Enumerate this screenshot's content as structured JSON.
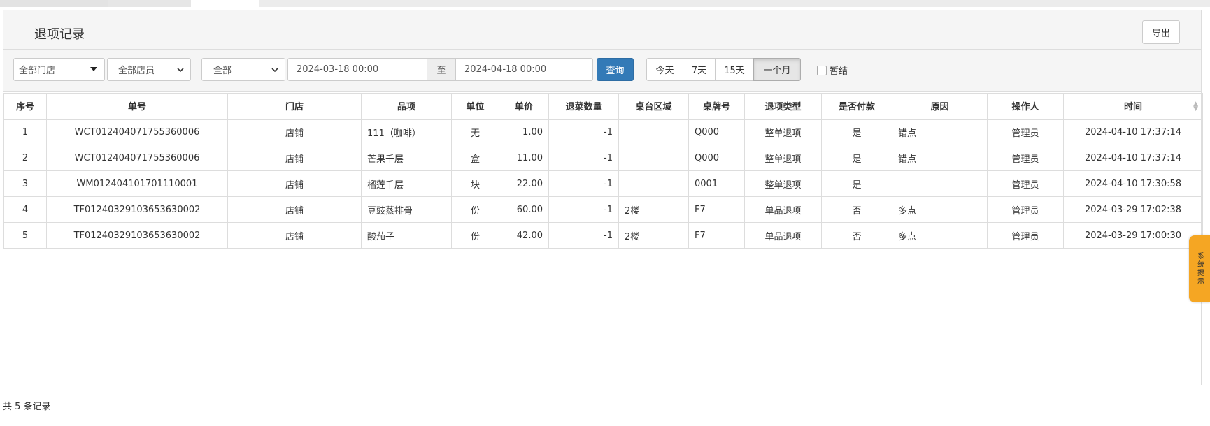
{
  "panel": {
    "title": "退项记录",
    "export_label": "导出"
  },
  "filters": {
    "store": "全部门店",
    "staff": "全部店员",
    "type": "全部",
    "date_start": "2024-03-18 00:00",
    "date_sep": "至",
    "date_end": "2024-04-18 00:00",
    "query_label": "查询",
    "ranges": [
      "今天",
      "7天",
      "15天",
      "一个月"
    ],
    "active_range": "一个月",
    "checkbox_label": "暂结",
    "checkbox_checked": false
  },
  "table": {
    "columns": [
      "序号",
      "单号",
      "门店",
      "品项",
      "单位",
      "单价",
      "退菜数量",
      "桌台区域",
      "桌牌号",
      "退项类型",
      "是否付款",
      "原因",
      "操作人",
      "时间"
    ],
    "rows": [
      [
        "1",
        "WCT012404071755360006",
        "店铺",
        "111（咖啡）",
        "无",
        "1.00",
        "-1",
        "",
        "Q000",
        "整单退项",
        "是",
        "错点",
        "管理员",
        "2024-04-10 17:37:14"
      ],
      [
        "2",
        "WCT012404071755360006",
        "店铺",
        "芒果千层",
        "盒",
        "11.00",
        "-1",
        "",
        "Q000",
        "整单退项",
        "是",
        "错点",
        "管理员",
        "2024-04-10 17:37:14"
      ],
      [
        "3",
        "WM012404101701110001",
        "店铺",
        "榴莲千层",
        "块",
        "22.00",
        "-1",
        "",
        "0001",
        "整单退项",
        "是",
        "",
        "管理员",
        "2024-04-10 17:30:58"
      ],
      [
        "4",
        "TF01240329103653630002",
        "店铺",
        "豆豉蒸排骨",
        "份",
        "60.00",
        "-1",
        "2楼",
        "F7",
        "单品退项",
        "否",
        "多点",
        "管理员",
        "2024-03-29 17:02:38"
      ],
      [
        "5",
        "TF01240329103653630002",
        "店铺",
        "酸茄子",
        "份",
        "42.00",
        "-1",
        "2楼",
        "F7",
        "单品退项",
        "否",
        "多点",
        "管理员",
        "2024-03-29 17:00:30"
      ]
    ]
  },
  "footer": {
    "record_count": "共 5 条记录"
  },
  "side_tip": {
    "label": "系统提示",
    "color": "#f5a623"
  },
  "colors": {
    "primary": "#337ab7",
    "border": "#dddddd"
  }
}
